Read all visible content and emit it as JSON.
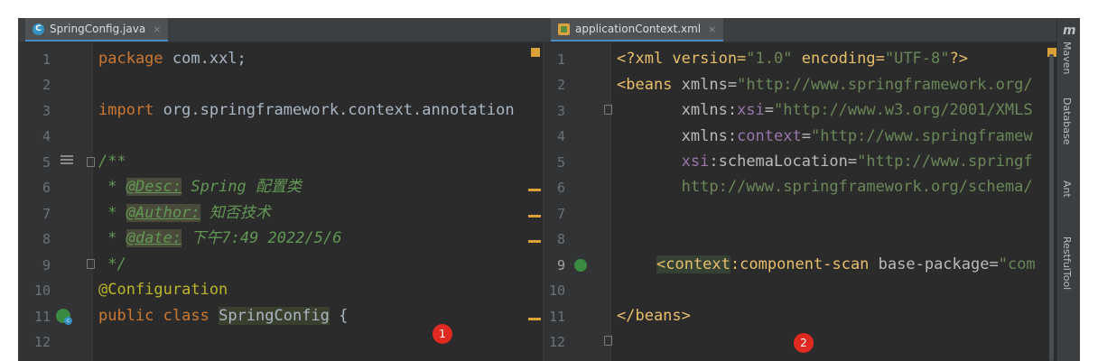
{
  "left_editor": {
    "tab_label": "SpringConfig.java",
    "tab_close": "×",
    "tab_icon_letter": "C",
    "line_numbers": [
      "1",
      "2",
      "3",
      "4",
      "5",
      "6",
      "7",
      "8",
      "9",
      "10",
      "11",
      "12"
    ],
    "lines": {
      "l1_kw": "package",
      "l1_rest": " com.xxl;",
      "l3_kw": "import",
      "l3_rest": " org.springframework.context.annotation",
      "l5": "/**",
      "l6_pre": " * ",
      "l6_tag": "@Desc:",
      "l6_text": " Spring 配置类",
      "l7_pre": " * ",
      "l7_tag": "@Author:",
      "l7_text": " 知否技术",
      "l8_pre": " * ",
      "l8_tag": "@date:",
      "l8_text": " 下午7:49 2022/5/6",
      "l9": " */",
      "l10": "@Configuration",
      "l11_kw": "public class",
      "l11_sp": " ",
      "l11_name": "SpringConfig",
      "l11_brace": " {"
    },
    "badge": "1"
  },
  "right_editor": {
    "tab_label": "applicationContext.xml",
    "tab_close": "×",
    "line_numbers": [
      "1",
      "2",
      "3",
      "4",
      "5",
      "6",
      "7",
      "8",
      "9",
      "10",
      "11",
      "12"
    ],
    "lines": {
      "l1_a": "<?xml version=",
      "l1_b": "\"1.0\"",
      "l1_c": " encoding=",
      "l1_d": "\"UTF-8\"",
      "l1_e": "?>",
      "l2_a": "<beans",
      "l2_b": " xmlns=",
      "l2_c": "\"http://www.springframework.org/",
      "l3_a": "       xmlns:",
      "l3_b": "xsi",
      "l3_c": "=",
      "l3_d": "\"http://www.w3.org/2001/XMLS",
      "l4_a": "       xmlns:",
      "l4_b": "context",
      "l4_c": "=",
      "l4_d": "\"http://www.springframew",
      "l5_a": "       ",
      "l5_b": "xsi",
      "l5_c": ":schemaLocation=",
      "l5_d": "\"http://www.springf",
      "l6": "       http://www.springframework.org/schema/",
      "l9_a": "<context",
      "l9_b": ":component-scan",
      "l9_c": " base-package=",
      "l9_d": "\"com",
      "l11": "</beans>"
    },
    "badge": "2"
  },
  "sidebar": {
    "logo": "m",
    "items": [
      "Maven",
      "Database",
      "Ant",
      "RestfulTool"
    ]
  }
}
